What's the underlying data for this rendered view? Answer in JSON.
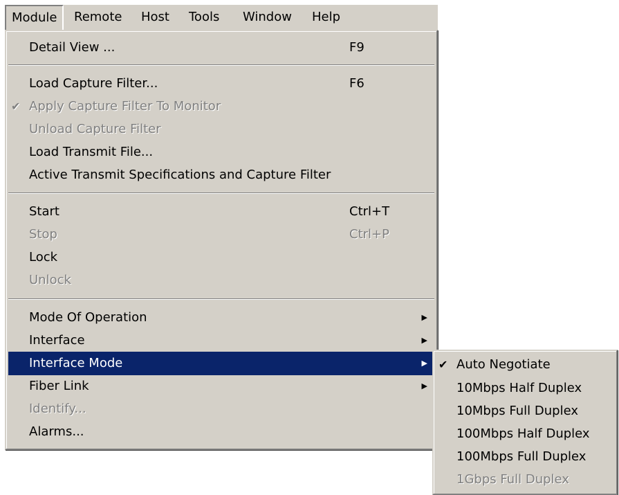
{
  "menubar": {
    "items": [
      {
        "label": "Module"
      },
      {
        "label": "Remote"
      },
      {
        "label": "Host"
      },
      {
        "label": "Tools"
      },
      {
        "label": "Window"
      },
      {
        "label": "Help"
      }
    ]
  },
  "module_menu": {
    "items": [
      {
        "label": "Detail View ...",
        "shortcut": "F9",
        "enabled": true
      },
      {
        "label": "Load Capture Filter...",
        "shortcut": "F6",
        "enabled": true
      },
      {
        "label": "Apply Capture Filter To Monitor",
        "enabled": false,
        "checked": true
      },
      {
        "label": "Unload Capture Filter",
        "enabled": false
      },
      {
        "label": "Load Transmit File...",
        "enabled": true
      },
      {
        "label": "Active Transmit Specifications and Capture Filter",
        "enabled": true
      },
      {
        "label": "Start",
        "shortcut": "Ctrl+T",
        "enabled": true
      },
      {
        "label": "Stop",
        "shortcut": "Ctrl+P",
        "enabled": false
      },
      {
        "label": "Lock",
        "enabled": true
      },
      {
        "label": "Unlock",
        "enabled": false
      },
      {
        "label": "Mode Of Operation",
        "enabled": true,
        "submenu": true
      },
      {
        "label": "Interface",
        "enabled": true,
        "submenu": true
      },
      {
        "label": "Interface Mode",
        "enabled": true,
        "submenu": true,
        "highlighted": true
      },
      {
        "label": "Fiber Link",
        "enabled": true,
        "submenu": true
      },
      {
        "label": "Identify...",
        "enabled": false
      },
      {
        "label": "Alarms...",
        "enabled": true
      }
    ]
  },
  "interface_mode_menu": {
    "items": [
      {
        "label": "Auto Negotiate",
        "checked": true,
        "enabled": true
      },
      {
        "label": "10Mbps Half Duplex",
        "enabled": true
      },
      {
        "label": "10Mbps Full Duplex",
        "enabled": true
      },
      {
        "label": "100Mbps Half Duplex",
        "enabled": true
      },
      {
        "label": "100Mbps Full Duplex",
        "enabled": true
      },
      {
        "label": "1Gbps Full Duplex",
        "enabled": false
      }
    ]
  },
  "icons": {
    "check": "✔",
    "submenu_arrow": "▶"
  }
}
